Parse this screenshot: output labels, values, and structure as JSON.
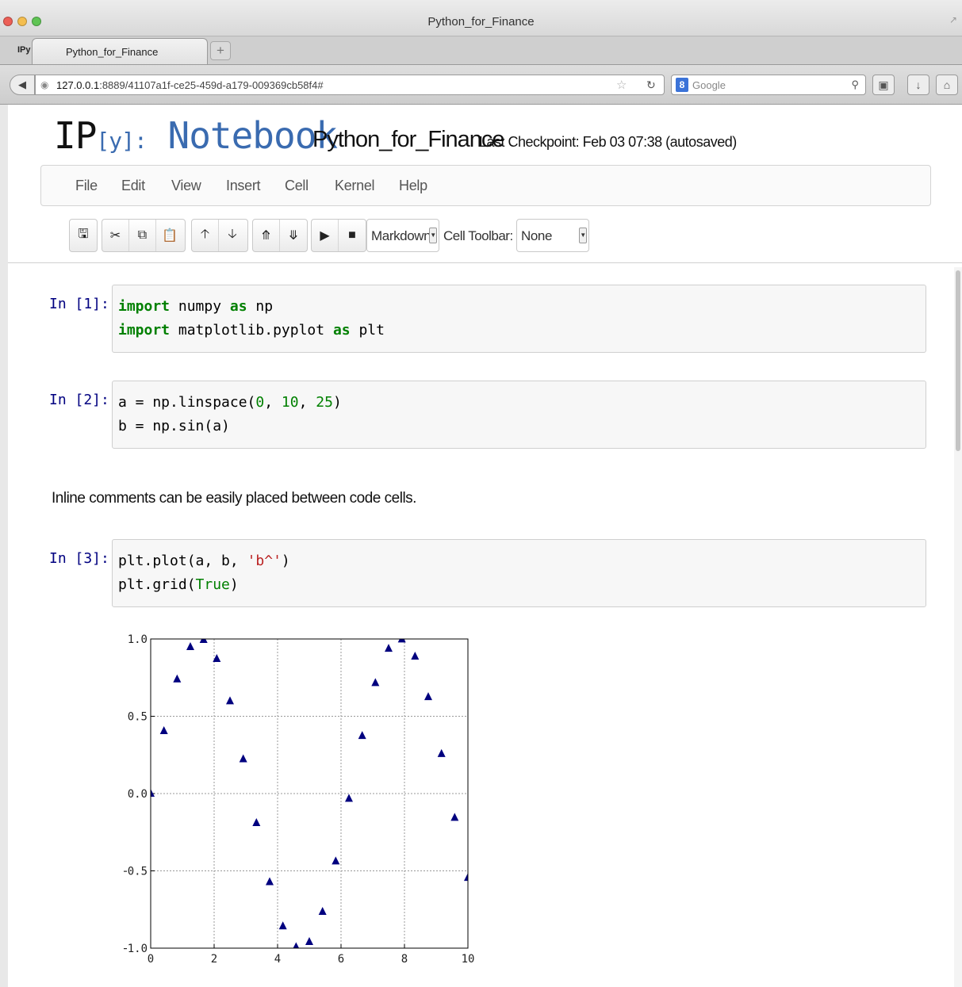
{
  "window": {
    "title": "Python_for_Finance",
    "tab_icon": "IPy",
    "tab_label": "Python_for_Finance",
    "new_tab": "+"
  },
  "browser": {
    "url_host": "127.0.0.1",
    "url_rest": ":8889/41107a1f-ce25-459d-a179-009369cb58f4#",
    "search_engine_letter": "8",
    "search_placeholder": "Google"
  },
  "notebook": {
    "logo_ip": "IP",
    "logo_y": "[y]:",
    "logo_word": "Notebook",
    "name": "Python_for_Finance",
    "checkpoint": "Last Checkpoint: Feb 03 07:38 (autosaved)"
  },
  "menu": [
    "File",
    "Edit",
    "View",
    "Insert",
    "Cell",
    "Kernel",
    "Help"
  ],
  "toolbar": {
    "cell_type": "Markdown",
    "cell_toolbar_label": "Cell Toolbar:",
    "cell_toolbar_value": "None",
    "icons": [
      "save-icon",
      "cut-icon",
      "copy-icon",
      "paste-icon",
      "move-up-icon",
      "move-down-icon",
      "insert-above-icon",
      "insert-below-icon",
      "run-icon",
      "stop-icon"
    ]
  },
  "cells": [
    {
      "prompt": "In [1]:",
      "lines": [
        [
          [
            "kw",
            "import"
          ],
          [
            "",
            " numpy "
          ],
          [
            "kw",
            "as"
          ],
          [
            "",
            " np"
          ]
        ],
        [
          [
            "kw",
            "import"
          ],
          [
            "",
            " matplotlib.pyplot "
          ],
          [
            "kw",
            "as"
          ],
          [
            "",
            " plt"
          ]
        ]
      ]
    },
    {
      "prompt": "In [2]:",
      "lines": [
        [
          [
            "",
            "a = np.linspace("
          ],
          [
            "num",
            "0"
          ],
          [
            "",
            ", "
          ],
          [
            "num",
            "10"
          ],
          [
            "",
            ", "
          ],
          [
            "num",
            "25"
          ],
          [
            "",
            ")"
          ]
        ],
        [
          [
            "",
            "b = np.sin(a)"
          ]
        ]
      ]
    },
    {
      "prompt": "In [3]:",
      "lines": [
        [
          [
            "",
            "plt.plot(a, b, "
          ],
          [
            "str",
            "'b^'"
          ],
          [
            "",
            ")"
          ]
        ],
        [
          [
            "",
            "plt.grid("
          ],
          [
            "builtin",
            "True"
          ],
          [
            "",
            ")"
          ]
        ]
      ]
    }
  ],
  "markdown": "Inline comments can be easily placed between code cells.",
  "chart_data": {
    "type": "scatter",
    "marker": "triangle-up",
    "color": "#00007f",
    "grid": true,
    "xlim": [
      0,
      10
    ],
    "ylim": [
      -1.0,
      1.0
    ],
    "xticks": [
      "0",
      "2",
      "4",
      "6",
      "8",
      "10"
    ],
    "yticks": [
      "1.0",
      "0.5",
      "0.0",
      "−0.5",
      "−1.0"
    ],
    "x": [
      0.0,
      0.417,
      0.833,
      1.25,
      1.667,
      2.083,
      2.5,
      2.917,
      3.333,
      3.75,
      4.167,
      4.583,
      5.0,
      5.417,
      5.833,
      6.25,
      6.667,
      7.083,
      7.5,
      7.917,
      8.333,
      8.75,
      9.167,
      9.583,
      10.0
    ],
    "y": [
      0.0,
      0.405,
      0.74,
      0.949,
      0.995,
      0.872,
      0.598,
      0.223,
      -0.19,
      -0.572,
      -0.858,
      -0.992,
      -0.959,
      -0.764,
      -0.438,
      -0.033,
      0.374,
      0.716,
      0.938,
      0.998,
      0.887,
      0.625,
      0.257,
      -0.156,
      -0.544
    ]
  }
}
